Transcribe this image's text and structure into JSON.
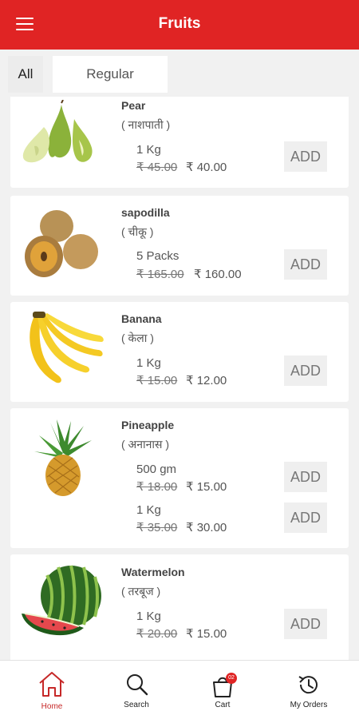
{
  "header": {
    "title": "Fruits",
    "menu_icon": "hamburger-menu-icon"
  },
  "tabs": [
    {
      "label": "All"
    },
    {
      "label": "Regular"
    }
  ],
  "products": [
    {
      "name": "Pear",
      "hindi": "( नाशपाती )",
      "variants": [
        {
          "qty": "1 Kg",
          "mrp": "₹ 45.00",
          "price": "₹ 40.00",
          "add": "ADD"
        }
      ]
    },
    {
      "name": "sapodilla",
      "hindi": "( चीकू )",
      "variants": [
        {
          "qty": "5 Packs",
          "mrp": "₹ 165.00",
          "price": "₹ 160.00",
          "add": "ADD"
        }
      ]
    },
    {
      "name": "Banana",
      "hindi": "( केला )",
      "variants": [
        {
          "qty": "1 Kg",
          "mrp": "₹ 15.00",
          "price": "₹ 12.00",
          "add": "ADD"
        }
      ]
    },
    {
      "name": "Pineapple",
      "hindi": "( अनानास )",
      "variants": [
        {
          "qty": "500 gm",
          "mrp": "₹ 18.00",
          "price": "₹ 15.00",
          "add": "ADD"
        },
        {
          "qty": "1 Kg",
          "mrp": "₹ 35.00",
          "price": "₹ 30.00",
          "add": "ADD"
        }
      ]
    },
    {
      "name": "Watermelon",
      "hindi": "( तरबूज )",
      "variants": [
        {
          "qty": "1 Kg",
          "mrp": "₹ 20.00",
          "price": "₹ 15.00",
          "add": "ADD"
        }
      ]
    }
  ],
  "bottom_nav": [
    {
      "label": "Home",
      "icon": "home-icon",
      "active": true
    },
    {
      "label": "Search",
      "icon": "search-icon"
    },
    {
      "label": "Cart",
      "icon": "cart-icon",
      "badge": "02"
    },
    {
      "label": "My Orders",
      "icon": "history-icon"
    }
  ],
  "colors": {
    "primary": "#e02424",
    "active_nav": "#c62828",
    "background": "#f1f1f1"
  }
}
